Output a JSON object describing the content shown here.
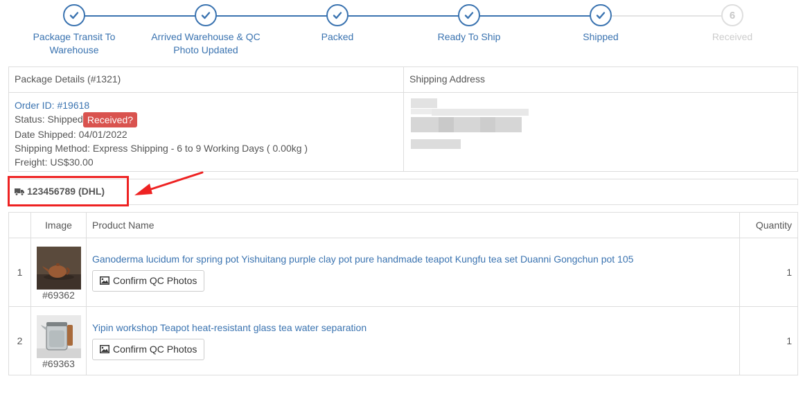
{
  "steps": [
    {
      "label": "Package Transit To Warehouse",
      "state": "done"
    },
    {
      "label": "Arrived Warehouse & QC Photo Updated",
      "state": "done"
    },
    {
      "label": "Packed",
      "state": "done"
    },
    {
      "label": "Ready To Ship",
      "state": "done"
    },
    {
      "label": "Shipped",
      "state": "done"
    },
    {
      "label": "Received",
      "state": "pending",
      "number": "6"
    }
  ],
  "package": {
    "details_header": "Package Details (#1321)",
    "address_header": "Shipping Address",
    "order_id": "Order ID: #19618",
    "status_label": "Status: Shipped",
    "received_button": "Received?",
    "date_shipped": "Date Shipped: 04/01/2022",
    "shipping_method": "Shipping Method: Express Shipping - 6 to 9 Working Days ( 0.00kg )",
    "freight": "Freight: US$30.00"
  },
  "tracking": {
    "number_carrier": "123456789 (DHL)"
  },
  "annotation": {
    "highlight_color": "#ee2222"
  },
  "table": {
    "headers": {
      "image": "Image",
      "product_name": "Product Name",
      "quantity": "Quantity"
    },
    "rows": [
      {
        "index": "1",
        "sku": "#69362",
        "name": "Ganoderma lucidum for spring pot Yishuitang purple clay pot pure handmade teapot Kungfu tea set Duanni Gongchun pot 105",
        "qc_button": "Confirm QC Photos",
        "quantity": "1",
        "thumb_icon": "clay-teapot-photo"
      },
      {
        "index": "2",
        "sku": "#69363",
        "name": "Yipin workshop Teapot heat-resistant glass tea water separation",
        "qc_button": "Confirm QC Photos",
        "quantity": "1",
        "thumb_icon": "glass-teapot-photo"
      }
    ]
  },
  "colors": {
    "accent": "#3a73b0",
    "danger": "#d9534f",
    "border": "#dddddd",
    "pending": "#cccccc"
  }
}
